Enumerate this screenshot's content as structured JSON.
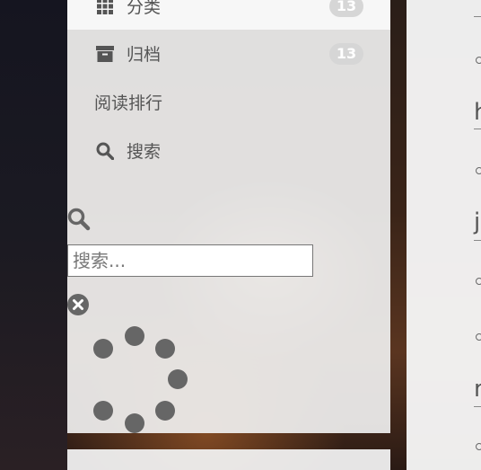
{
  "menu": {
    "items": [
      {
        "label": "分类",
        "count": "13",
        "icon": "grid-icon"
      },
      {
        "label": "归档",
        "count": "13",
        "icon": "archive-icon"
      },
      {
        "label": "阅读排行"
      },
      {
        "label": "搜索",
        "icon": "search-icon"
      }
    ]
  },
  "search": {
    "placeholder": "搜索...",
    "value": ""
  },
  "content": {
    "heading_letters": [
      "h",
      "j",
      "n"
    ]
  },
  "colors": {
    "sidebar_bg": "#f0f0f0",
    "text": "#555555",
    "badge": "#d6d6d6",
    "spinner": "#666666"
  }
}
